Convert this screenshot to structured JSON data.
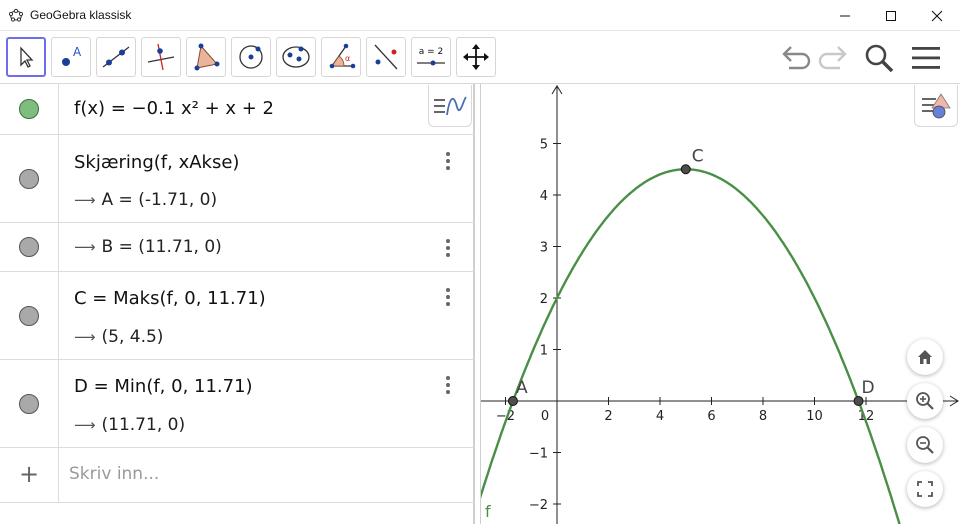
{
  "window": {
    "title": "GeoGebra klassisk",
    "minimize_icon": "minimize-icon",
    "maximize_icon": "maximize-icon",
    "close_icon": "close-icon"
  },
  "toolbar": {
    "tools": [
      {
        "name": "move-tool",
        "icon": "arrow-cursor-icon",
        "active": true
      },
      {
        "name": "point-tool",
        "icon": "point-icon",
        "label": "A"
      },
      {
        "name": "line-tool",
        "icon": "line-icon"
      },
      {
        "name": "perpendicular-line-tool",
        "icon": "perpendicular-icon"
      },
      {
        "name": "polygon-tool",
        "icon": "polygon-icon"
      },
      {
        "name": "circle-tool",
        "icon": "circle-icon"
      },
      {
        "name": "conic-tool",
        "icon": "ellipse-icon"
      },
      {
        "name": "angle-tool",
        "icon": "angle-icon",
        "label": "α"
      },
      {
        "name": "reflect-tool",
        "icon": "reflect-icon"
      },
      {
        "name": "slider-tool",
        "icon": "slider-icon",
        "label": "a = 2"
      },
      {
        "name": "move-graphics-tool",
        "icon": "move-arrows-icon"
      }
    ],
    "right": [
      "undo-icon",
      "redo-icon",
      "search-icon",
      "menu-icon"
    ]
  },
  "algebra": {
    "rows": [
      {
        "name": "row-f",
        "dot_color": "#7dbd7d",
        "input": "f(x)  =  −0.1 x² + x + 2"
      },
      {
        "name": "row-A",
        "dot_color": "#a9a9a9",
        "input": "Skjæring(f, xAkse)",
        "output": "A  =  (-1.71,  0)"
      },
      {
        "name": "row-B",
        "dot_color": "#a9a9a9",
        "output": "B  =  (11.71,  0)"
      },
      {
        "name": "row-C",
        "dot_color": "#a9a9a9",
        "input": "C  =  Maks(f, 0, 11.71)",
        "output": "(5,  4.5)"
      },
      {
        "name": "row-D",
        "dot_color": "#a9a9a9",
        "input": "D  =  Min(f, 0, 11.71)",
        "output": "(11.71,  0)"
      }
    ],
    "input_placeholder": "Skriv inn...",
    "plus": "+"
  },
  "graphics": {
    "function_label": "f",
    "curve_color": "#4a8f46",
    "x_ticks": [
      "−2",
      "0",
      "2",
      "4",
      "6",
      "8",
      "10",
      "12"
    ],
    "y_ticks": [
      "5",
      "4",
      "3",
      "2",
      "1",
      "−1",
      "−2"
    ],
    "points": [
      {
        "label": "A",
        "x": -1.71,
        "y": 0
      },
      {
        "label": "C",
        "x": 5,
        "y": 4.5
      },
      {
        "label": "D",
        "x": 11.71,
        "y": 0
      }
    ],
    "zoom_buttons": [
      "home-icon",
      "zoom-in-icon",
      "zoom-out-icon",
      "fullscreen-icon"
    ]
  },
  "chart_data": {
    "type": "line",
    "title": "",
    "xlabel": "",
    "ylabel": "",
    "xlim": [
      -3,
      15.5
    ],
    "ylim": [
      -2.3,
      6.1
    ],
    "grid": false,
    "series": [
      {
        "name": "f",
        "function": "−0.1 x² + x + 2",
        "x": [
          -3,
          -2,
          0,
          2,
          4,
          5,
          6,
          8,
          10,
          11.71,
          12,
          13.5
        ],
        "y": [
          -1.9,
          -0.4,
          2,
          3.6,
          4.4,
          4.5,
          4.4,
          3.6,
          2,
          0,
          -0.4,
          -2.73
        ]
      }
    ],
    "points": [
      {
        "label": "A",
        "x": -1.71,
        "y": 0
      },
      {
        "label": "C",
        "x": 5,
        "y": 4.5
      },
      {
        "label": "D",
        "x": 11.71,
        "y": 0
      }
    ]
  }
}
